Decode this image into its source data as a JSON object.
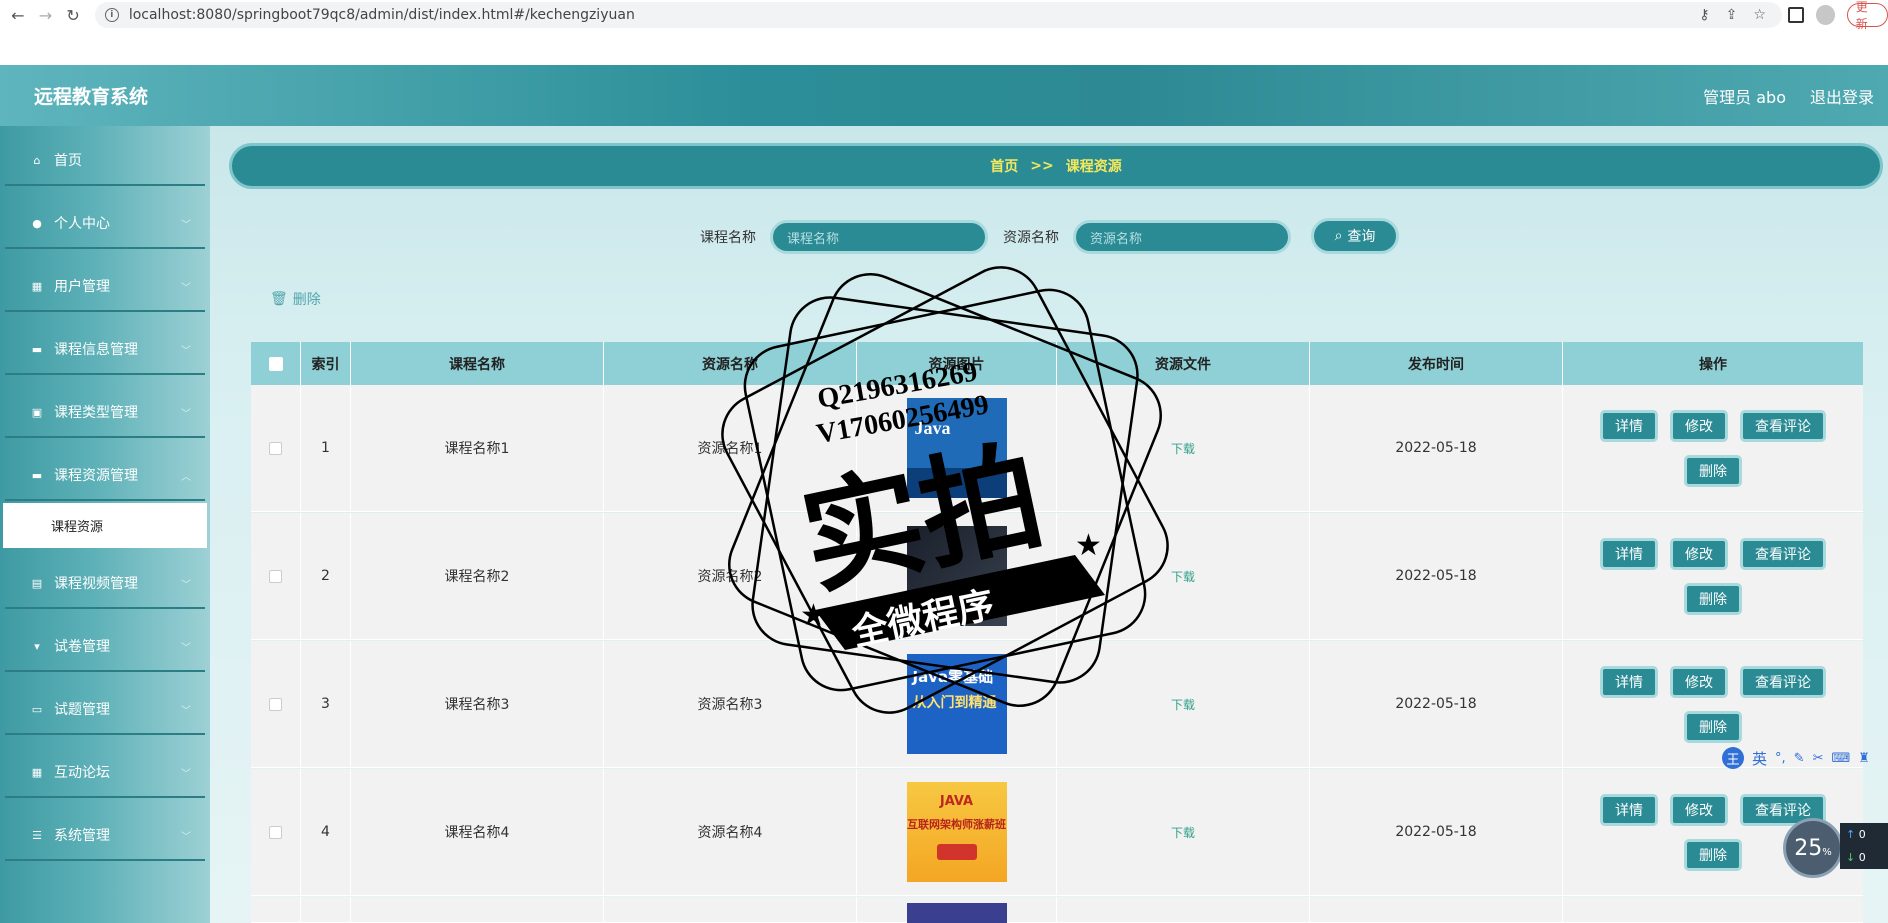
{
  "browser": {
    "url": "localhost:8080/springboot79qc8/admin/dist/index.html#/kechengziyuan",
    "update_label": "更新"
  },
  "header": {
    "title": "远程教育系统",
    "user": "管理员 abo",
    "logout": "退出登录"
  },
  "sidebar": {
    "items": [
      {
        "label": "首页",
        "icon": "home-icon"
      },
      {
        "label": "个人中心",
        "icon": "user-icon"
      },
      {
        "label": "用户管理",
        "icon": "grid-icon"
      },
      {
        "label": "课程信息管理",
        "icon": "monitor-icon"
      },
      {
        "label": "课程类型管理",
        "icon": "chart-icon"
      },
      {
        "label": "课程资源管理",
        "icon": "monitor-icon"
      },
      {
        "label": "课程视频管理",
        "icon": "film-icon"
      },
      {
        "label": "试卷管理",
        "icon": "stand-icon"
      },
      {
        "label": "试题管理",
        "icon": "suitcase-icon"
      },
      {
        "label": "互动论坛",
        "icon": "grid-icon"
      },
      {
        "label": "系统管理",
        "icon": "sliders-icon"
      }
    ],
    "active_sub": "课程资源"
  },
  "breadcrumb": {
    "home": "首页",
    "sep": ">>",
    "current": "课程资源"
  },
  "search": {
    "course_label": "课程名称",
    "course_placeholder": "课程名称",
    "resource_label": "资源名称",
    "resource_placeholder": "资源名称",
    "button": "查询"
  },
  "toolbar": {
    "delete_label": "删除"
  },
  "table": {
    "headers": [
      "索引",
      "课程名称",
      "资源名称",
      "资源图片",
      "资源文件",
      "发布时间",
      "操作"
    ],
    "rows": [
      {
        "index": "1",
        "course": "课程名称1",
        "resource": "资源名称1",
        "file": "下载",
        "date": "2022-05-18"
      },
      {
        "index": "2",
        "course": "课程名称2",
        "resource": "资源名称2",
        "file": "下载",
        "date": "2022-05-18"
      },
      {
        "index": "3",
        "course": "课程名称3",
        "resource": "资源名称3",
        "file": "下载",
        "date": "2022-05-18"
      },
      {
        "index": "4",
        "course": "课程名称4",
        "resource": "资源名称4",
        "file": "下载",
        "date": "2022-05-18"
      }
    ],
    "ops": {
      "detail": "详情",
      "edit": "修改",
      "comments": "查看评论",
      "delete": "删除"
    }
  },
  "covers": {
    "c1": "Java",
    "c3a": "Java零基础",
    "c3b": "从入门到精通",
    "c4a": "JAVA",
    "c4b": "互联网架构师涨薪班"
  },
  "watermark": {
    "line1": "Q2196316269",
    "line2": "V17060256499",
    "big": "实拍",
    "banner": "全微程序"
  },
  "ime": {
    "brand": "王",
    "lang": "英"
  },
  "speed": {
    "value": "25",
    "unit": "%",
    "up": "0",
    "down": "0"
  }
}
